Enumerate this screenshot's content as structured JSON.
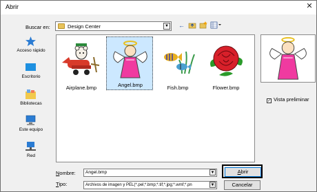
{
  "window": {
    "title": "Abrir",
    "close_glyph": "✕"
  },
  "lookin": {
    "label": "Buscar en:",
    "value": "Design Center"
  },
  "toolbar": {
    "back_icon": "back-arrow-icon",
    "up_icon": "up-folder-icon",
    "new_icon": "new-folder-icon",
    "view_icon": "view-menu-icon"
  },
  "places": [
    {
      "label": "Acceso rápido",
      "icon": "star-icon"
    },
    {
      "label": "Escritorio",
      "icon": "desktop-icon"
    },
    {
      "label": "Bibliotecas",
      "icon": "libraries-icon"
    },
    {
      "label": "Este equipo",
      "icon": "computer-icon"
    },
    {
      "label": "Red",
      "icon": "network-icon"
    }
  ],
  "files": [
    {
      "name": "Airplane.bmp",
      "selected": false
    },
    {
      "name": "Angel.bmp",
      "selected": true
    },
    {
      "name": "Fish.bmp",
      "selected": false
    },
    {
      "name": "Flower.bmp",
      "selected": false
    }
  ],
  "preview": {
    "checkbox_label": "Vista preliminar",
    "checked": true
  },
  "footer": {
    "name_label_u": "N",
    "name_label_rest": "ombre:",
    "name_value": "Angel.bmp",
    "type_label_u": "T",
    "type_label_rest": "ipo:",
    "type_value": "Archivos de imagen y PEL(*.pel;*.bmp;*.tif;*.jpg;*.wmf;*.pn",
    "open_label_u": "A",
    "open_label_rest": "brir",
    "cancel_label": "Cancelar"
  }
}
